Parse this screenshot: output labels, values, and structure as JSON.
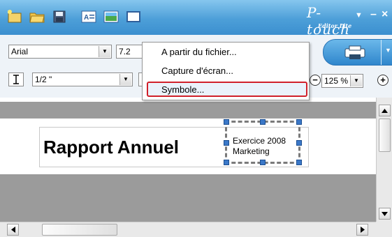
{
  "titlebar": {
    "logo_main": "P-touch",
    "logo_sub": "Editor Lite",
    "icons": [
      "new-label-icon",
      "open-folder-icon",
      "save-icon",
      "text-icon",
      "image-icon",
      "frame-icon"
    ]
  },
  "toolbar": {
    "font_name": "Arial",
    "font_size": "7.2",
    "tape_width": "1/2 \"",
    "zoom": "125 %"
  },
  "menu": {
    "items": [
      {
        "label": "A partir du fichier..."
      },
      {
        "label": "Capture d'écran..."
      },
      {
        "label": "Symbole..."
      }
    ]
  },
  "label": {
    "title": "Rapport Annuel",
    "selected_line1": "Exercice 2008",
    "selected_line2": "Marketing"
  }
}
